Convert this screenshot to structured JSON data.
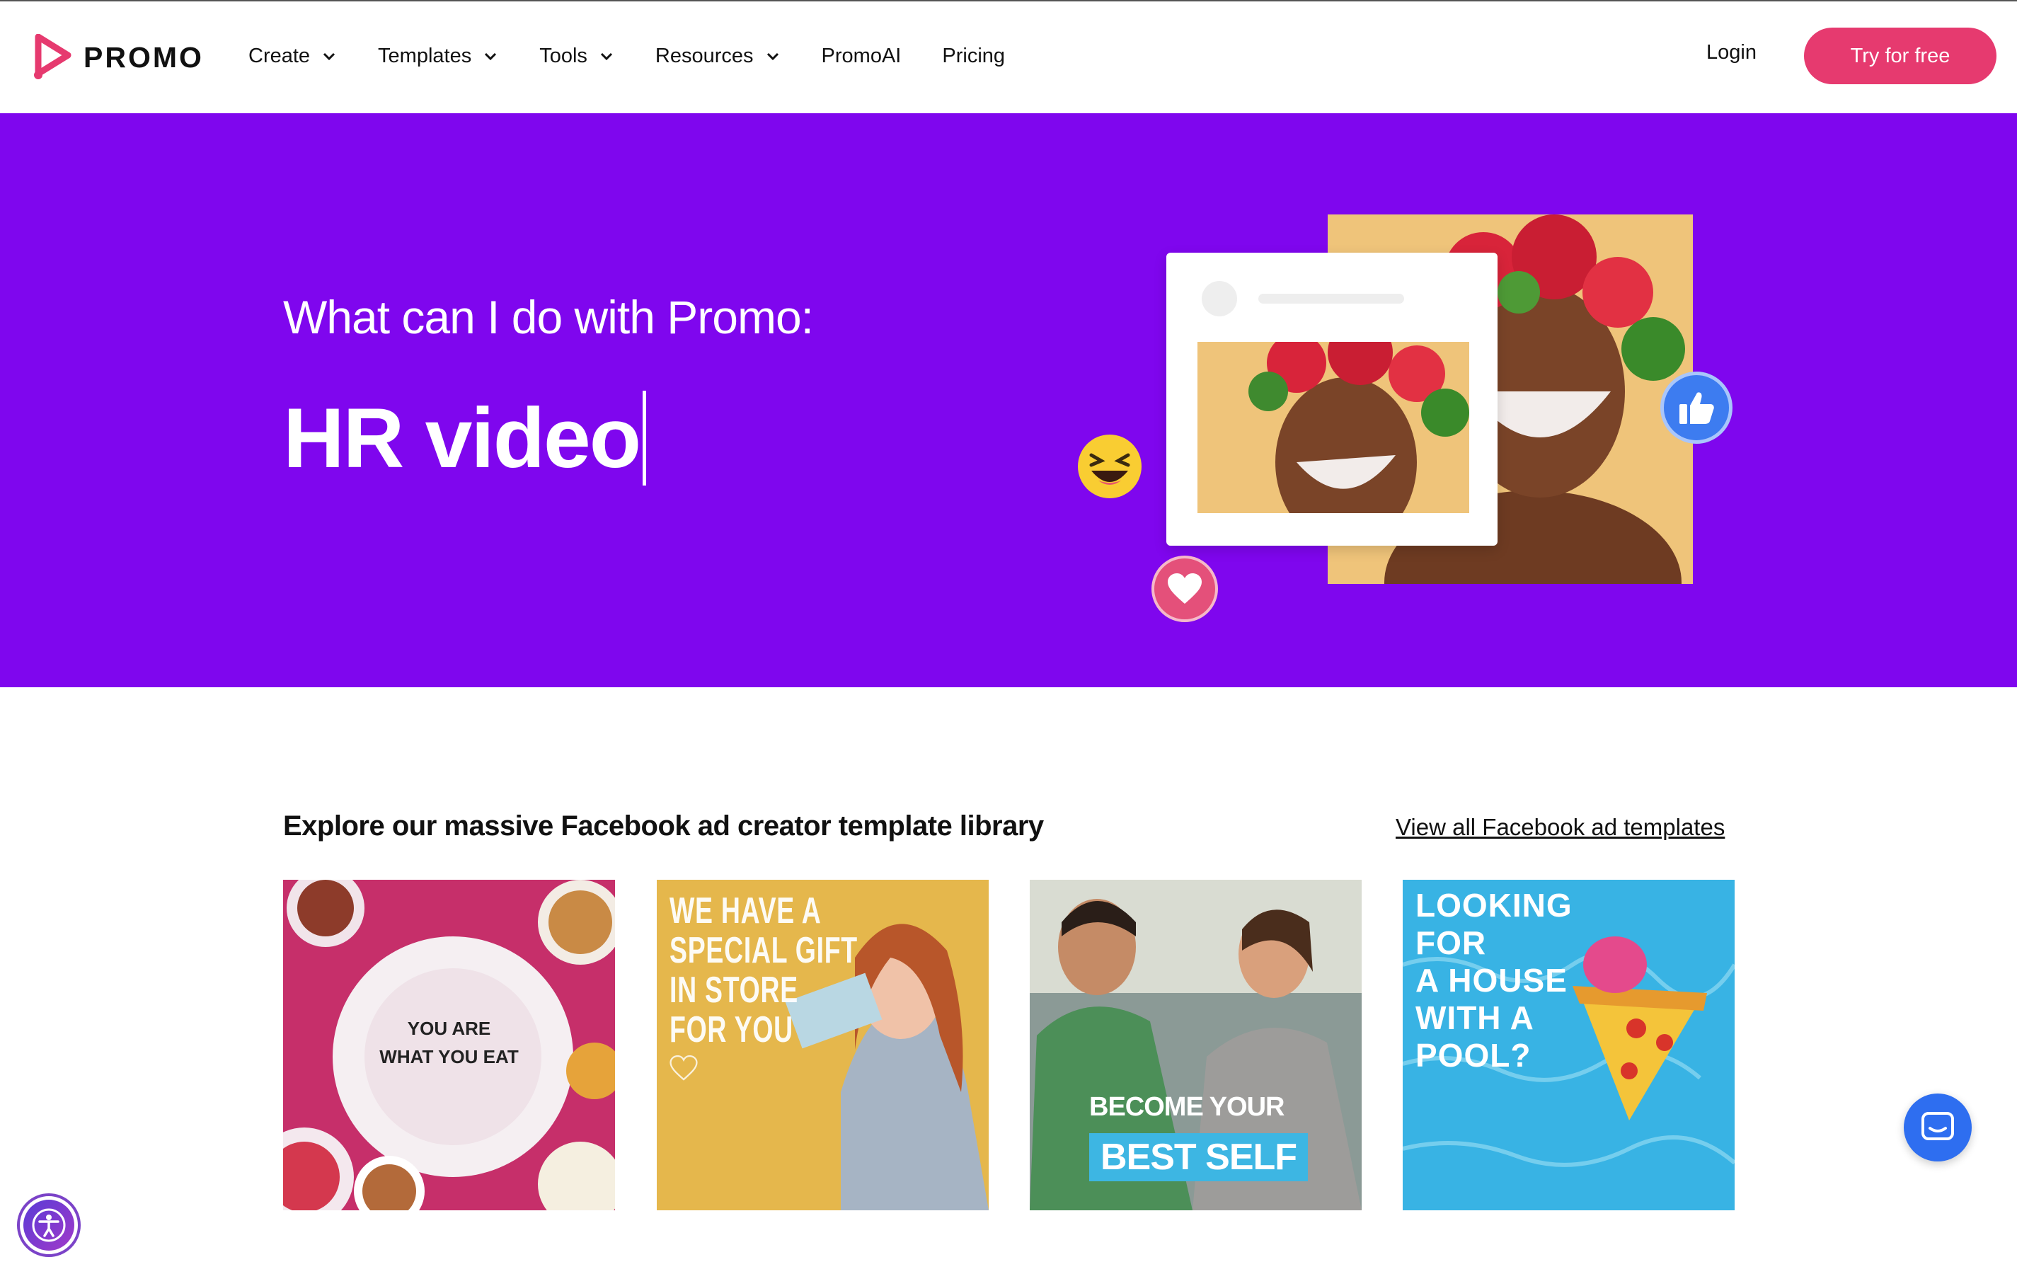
{
  "brand": {
    "name": "PROMO",
    "accent": "#e63a6f",
    "hero_bg": "#7f06ee"
  },
  "nav": {
    "items": [
      {
        "label": "Create",
        "has_dropdown": true
      },
      {
        "label": "Templates",
        "has_dropdown": true
      },
      {
        "label": "Tools",
        "has_dropdown": true
      },
      {
        "label": "Resources",
        "has_dropdown": true
      },
      {
        "label": "PromoAI",
        "has_dropdown": false
      },
      {
        "label": "Pricing",
        "has_dropdown": false
      }
    ],
    "login_label": "Login",
    "cta_label": "Try for free"
  },
  "hero": {
    "subtitle": "What can I do with Promo:",
    "typed_text": "HR video",
    "reactions": [
      "laughing-emoji",
      "heart-reaction",
      "like-reaction"
    ]
  },
  "explore": {
    "title_prefix": "Explore our massive ",
    "title_bold": "Facebook ad creator",
    "title_suffix": " template library",
    "view_all_label": "View all Facebook ad templates",
    "templates": [
      {
        "lines": [
          "YOU ARE",
          "WHAT YOU EAT"
        ]
      },
      {
        "lines": [
          "WE HAVE A",
          "SPECIAL GIFT",
          "IN STORE",
          "FOR YOU"
        ]
      },
      {
        "line1": "BECOME YOUR",
        "badge": "BEST SELF"
      },
      {
        "lines": [
          "LOOKING",
          "FOR",
          "A HOUSE",
          "WITH A",
          "POOL?"
        ]
      }
    ]
  },
  "widgets": {
    "chat": "chat-icon",
    "accessibility": "accessibility-icon"
  }
}
